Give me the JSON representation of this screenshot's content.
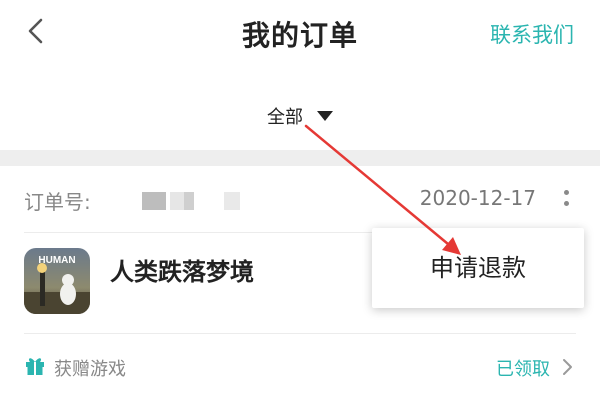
{
  "header": {
    "back_icon": "chevron-left-icon",
    "title": "我的订单",
    "contact_label": "联系我们"
  },
  "filter": {
    "label": "全部",
    "icon": "caret-down-icon"
  },
  "order": {
    "number_label": "订单号:",
    "date": "2020-12-17",
    "more_icon": "more-vertical-icon",
    "game_name": "人类跌落梦境",
    "game_icon_text": "HUMAN",
    "gift_icon": "gift-icon",
    "gift_label": "获赠游戏",
    "gift_status": "已领取",
    "chevron_icon": "chevron-right-icon"
  },
  "popup": {
    "refund_label": "申请退款"
  },
  "annotation": {
    "arrow_color": "#e53935"
  },
  "colors": {
    "accent": "#2bb5b0",
    "text_primary": "#222222",
    "text_secondary": "#888888",
    "section_gap": "#eeeeee"
  }
}
